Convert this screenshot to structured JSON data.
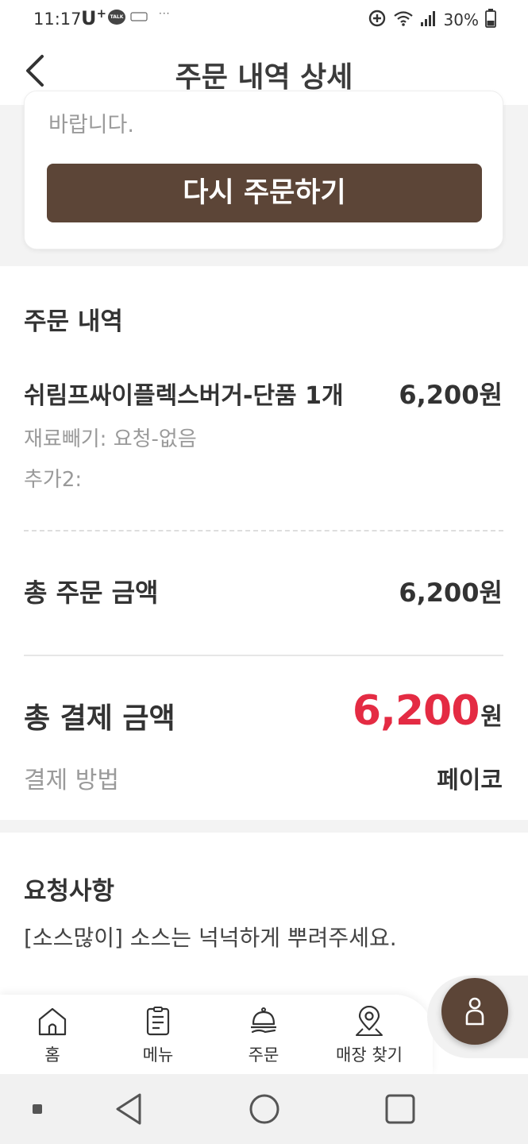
{
  "status_bar": {
    "time": "11:17",
    "carrier": "U",
    "carrier_plus": "+",
    "talk_badge": "TALK",
    "more_dots": "···",
    "battery": "30%"
  },
  "header": {
    "title": "주문 내역 상세"
  },
  "reorder_card": {
    "note": "바랍니다.",
    "button_label": "다시 주문하기"
  },
  "order_details": {
    "title": "주문 내역",
    "items": [
      {
        "name": "쉬림프싸이플렉스버거-단품 1개",
        "price": "6,200원",
        "options": [
          "재료빼기: 요청-없음",
          "추가2:"
        ]
      }
    ],
    "total_order_label": "총 주문 금액",
    "total_order_value": "6,200원",
    "total_payment_label": "총 결제 금액",
    "total_payment_value": "6,200",
    "total_payment_unit": "원",
    "payment_method_label": "결제 방법",
    "payment_method_value": "페이코"
  },
  "request": {
    "title": "요청사항",
    "text": "[소스많이] 소스는 넉넉하게 뿌려주세요."
  },
  "bottom_nav": {
    "items": [
      {
        "label": "홈",
        "icon": "home-icon"
      },
      {
        "label": "메뉴",
        "icon": "menu-icon"
      },
      {
        "label": "주문",
        "icon": "order-icon"
      },
      {
        "label": "매장 찾기",
        "icon": "location-icon"
      }
    ],
    "fab_icon": "person-icon"
  },
  "colors": {
    "brand_brown": "#5c4537",
    "price_red": "#e42b43"
  }
}
